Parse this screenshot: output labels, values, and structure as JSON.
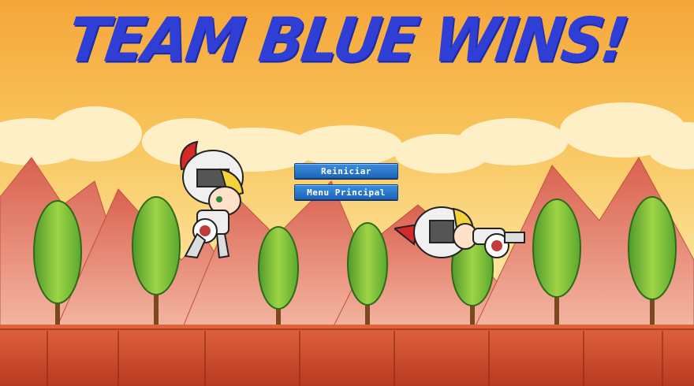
{
  "screen": {
    "title": "TEAM BLUE WINS!",
    "title_color": "#2f3fd6"
  },
  "menu": {
    "restart_label": "Reiniciar",
    "main_menu_label": "Menu Principal",
    "button_color": "#2a78d0"
  },
  "scene": {
    "sky_top_color": "#f5a63a",
    "sky_bottom_color": "#fde9a3",
    "mountain_color": "#e9836e",
    "ground_color": "#c6442a",
    "tree_color": "#7cc23a"
  },
  "characters": [
    {
      "name": "knight-standing",
      "team": "red-plume"
    },
    {
      "name": "knight-fallen",
      "team": "red-plume"
    }
  ]
}
